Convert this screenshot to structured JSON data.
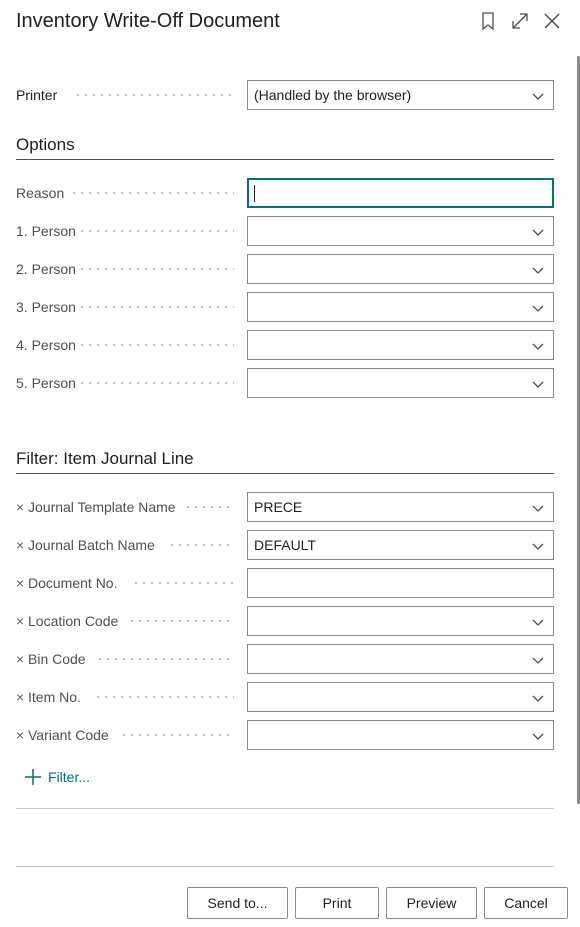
{
  "dialog": {
    "title": "Inventory Write-Off Document"
  },
  "printer": {
    "label": "Printer",
    "value": "(Handled by the browser)"
  },
  "options": {
    "title": "Options",
    "reason": {
      "label": "Reason",
      "value": ""
    },
    "persons": [
      {
        "label": "1. Person",
        "value": ""
      },
      {
        "label": "2. Person",
        "value": ""
      },
      {
        "label": "3. Person",
        "value": ""
      },
      {
        "label": "4. Person",
        "value": ""
      },
      {
        "label": "5. Person",
        "value": ""
      }
    ]
  },
  "filter": {
    "title": "Filter: Item Journal Line",
    "clear_glyph": "×",
    "fields": [
      {
        "label": "Journal Template Name",
        "value": "PRECE"
      },
      {
        "label": "Journal Batch Name",
        "value": "DEFAULT"
      },
      {
        "label": "Document No.",
        "value": ""
      },
      {
        "label": "Location Code",
        "value": ""
      },
      {
        "label": "Bin Code",
        "value": ""
      },
      {
        "label": "Item No.",
        "value": ""
      },
      {
        "label": "Variant Code",
        "value": ""
      }
    ],
    "add_label": "Filter..."
  },
  "footer": {
    "send_to": "Send to...",
    "print": "Print",
    "preview": "Preview",
    "cancel": "Cancel"
  },
  "colors": {
    "accent": "#00727a",
    "border": "#8a8a8a",
    "text": "#212121",
    "label": "#505050"
  },
  "icons": [
    "bookmark-icon",
    "expand-icon",
    "close-icon",
    "chevron-down-icon",
    "plus-icon"
  ]
}
